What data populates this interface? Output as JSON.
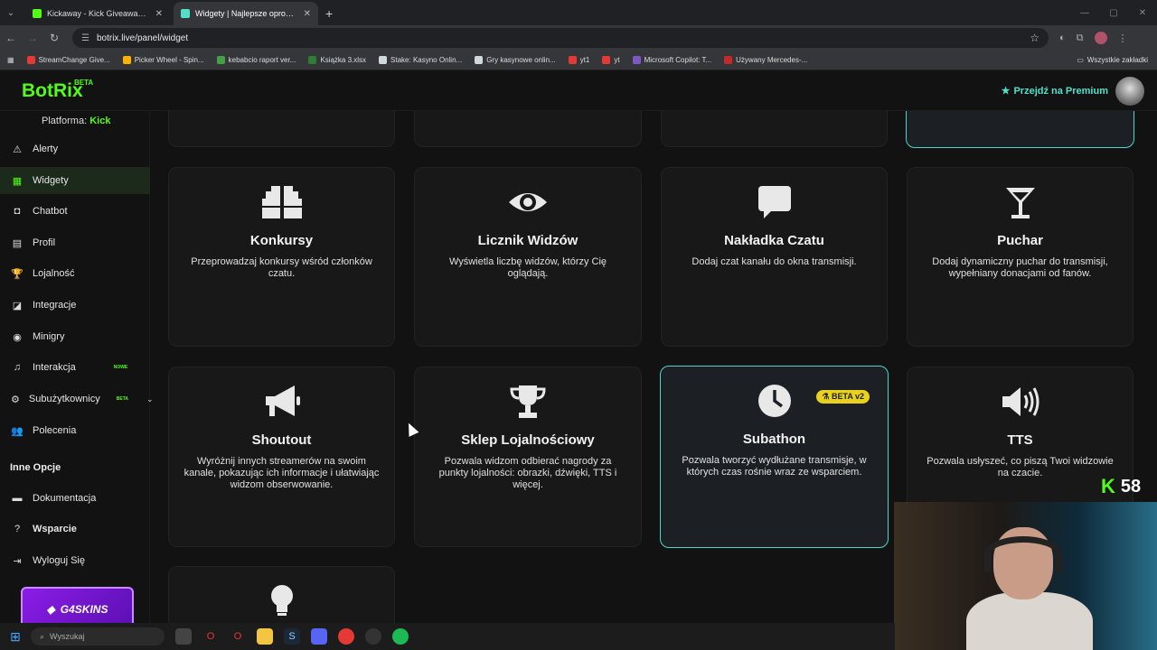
{
  "browser": {
    "tabs": [
      {
        "title": "Kickaway - Kick Giveaway Tool",
        "close": "✕"
      },
      {
        "title": "Widgety | Najlepsze oprogramo",
        "close": "✕"
      }
    ],
    "new_tab": "+",
    "url": "botrix.live/panel/widget",
    "bookmarks": [
      {
        "label": "StreamChange Give...",
        "color": "#e53935"
      },
      {
        "label": "Picker Wheel - Spin...",
        "color": "#ffb300"
      },
      {
        "label": "kebabcio raport ver...",
        "color": "#43a047"
      },
      {
        "label": "Książka 3.xlsx",
        "color": "#2e7d32"
      },
      {
        "label": "Stake: Kasyno Onlin...",
        "color": "#cfd8dc"
      },
      {
        "label": "Gry kasynowe onlin...",
        "color": "#cfd8dc"
      },
      {
        "label": "yt1",
        "color": "#e53935"
      },
      {
        "label": "yt",
        "color": "#e53935"
      },
      {
        "label": "Microsoft Copilot: T...",
        "color": "#7e57c2"
      },
      {
        "label": "Używany Mercedes-...",
        "color": "#c62828"
      }
    ],
    "all_bookmarks": "Wszystkie zakładki"
  },
  "header": {
    "logo": "BotRix",
    "logo_tag": "BETA",
    "premium": "Przejdź na Premium"
  },
  "sidebar": {
    "platform_label": "Platforma:",
    "platform_value": "Kick",
    "items": [
      {
        "label": "Alerty",
        "icon": "⚠"
      },
      {
        "label": "Widgety",
        "icon": "▦"
      },
      {
        "label": "Chatbot",
        "icon": "◘"
      },
      {
        "label": "Profil",
        "icon": "▤"
      },
      {
        "label": "Lojalność",
        "icon": "🏆"
      },
      {
        "label": "Integracje",
        "icon": "◪"
      },
      {
        "label": "Minigry",
        "icon": "◉"
      },
      {
        "label": "Interakcja",
        "icon": "♫",
        "badge": "NOWE"
      },
      {
        "label": "Subużytkownicy",
        "icon": "⚙",
        "badge": "BETA"
      },
      {
        "label": "Polecenia",
        "icon": "👥"
      }
    ],
    "section_other": "Inne Opcje",
    "other_items": [
      {
        "label": "Dokumentacja",
        "icon": "▬"
      },
      {
        "label": "Wsparcie",
        "icon": "?"
      },
      {
        "label": "Wyloguj Się",
        "icon": "⇥"
      }
    ],
    "promo": "G4SKINS"
  },
  "widgets": [
    {
      "title": "Konkursy",
      "desc": "Przeprowadzaj konkursy wśród członków czatu.",
      "icon": "gift-icon"
    },
    {
      "title": "Licznik Widzów",
      "desc": "Wyświetla liczbę widzów, którzy Cię oglądają.",
      "icon": "eye-icon"
    },
    {
      "title": "Nakładka Czatu",
      "desc": "Dodaj czat kanału do okna transmisji.",
      "icon": "chat-icon"
    },
    {
      "title": "Puchar",
      "desc": "Dodaj dynamiczny puchar do transmisji, wypełniany donacjami od fanów.",
      "icon": "cup-icon"
    },
    {
      "title": "Shoutout",
      "desc": "Wyróżnij innych streamerów na swoim kanale, pokazując ich informacje i ułatwiając widzom obserwowanie.",
      "icon": "megaphone-icon"
    },
    {
      "title": "Sklep Lojalnościowy",
      "desc": "Pozwala widzom odbierać nagrody za punkty lojalności: obrazki, dźwięki, TTS i więcej.",
      "icon": "trophy-icon"
    },
    {
      "title": "Subathon",
      "desc": "Pozwala tworzyć wydłużane transmisje, w których czas rośnie wraz ze wsparciem.",
      "icon": "clock-icon",
      "badge": "BETA v2"
    },
    {
      "title": "TTS",
      "desc": "Pozwala usłyszeć, co piszą Twoi widzowie na czacie.",
      "icon": "speaker-icon"
    }
  ],
  "overlay": {
    "kick_count": "58"
  },
  "taskbar": {
    "search_placeholder": "Wyszukaj"
  }
}
